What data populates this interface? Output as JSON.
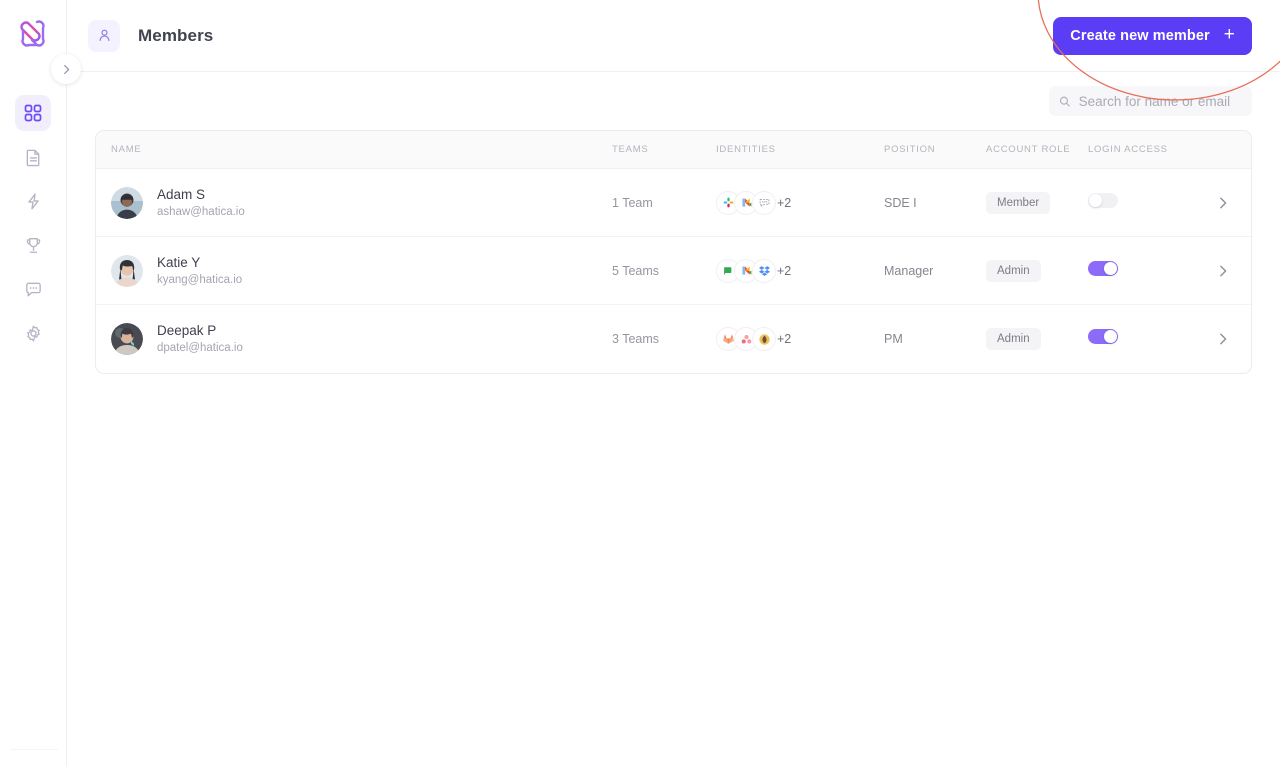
{
  "brand": {
    "logo_name": "hatica-logo",
    "accent": "#5b3df5",
    "accent_light": "#8b6bf7",
    "annotation_color": "#e8705a"
  },
  "sidebar": {
    "items": [
      {
        "icon": "grid-icon",
        "label": "Dashboard",
        "active": true
      },
      {
        "icon": "document-icon",
        "label": "Reports",
        "active": false
      },
      {
        "icon": "bolt-icon",
        "label": "Activity",
        "active": false
      },
      {
        "icon": "trophy-icon",
        "label": "Goals",
        "active": false
      },
      {
        "icon": "chat-icon",
        "label": "Feedback",
        "active": false
      },
      {
        "icon": "gear-icon",
        "label": "Settings",
        "active": false
      }
    ],
    "collapse_icon": "chevron-right-icon"
  },
  "header": {
    "icon": "person-icon",
    "title": "Members",
    "create_button": {
      "label": "Create new member",
      "icon": "plus-icon"
    }
  },
  "search": {
    "placeholder": "Search for name or email",
    "value": "",
    "icon": "search-icon"
  },
  "table": {
    "columns": [
      {
        "key": "name",
        "label": "NAME"
      },
      {
        "key": "teams",
        "label": "TEAMS"
      },
      {
        "key": "ident",
        "label": "IDENTITIES"
      },
      {
        "key": "pos",
        "label": "POSITION"
      },
      {
        "key": "role",
        "label": "ACCOUNT ROLE"
      },
      {
        "key": "login",
        "label": "LOGIN ACCESS"
      }
    ],
    "rows": [
      {
        "name": "Adam S",
        "email": "ashaw@hatica.io",
        "teams": "1 Team",
        "identities": [
          "slack-icon",
          "google-meet-icon",
          "chat-bubble-icon"
        ],
        "identities_more": "+2",
        "position": "SDE I",
        "account_role": "Member",
        "login_access": false,
        "arrow_icon": "chevron-right-icon"
      },
      {
        "name": "Katie Y",
        "email": "kyang@hatica.io",
        "teams": "5 Teams",
        "identities": [
          "green-flag-icon",
          "google-meet-icon",
          "dropbox-icon"
        ],
        "identities_more": "+2",
        "position": "Manager",
        "account_role": "Admin",
        "login_access": true,
        "arrow_icon": "chevron-right-icon"
      },
      {
        "name": "Deepak P",
        "email": "dpatel@hatica.io",
        "teams": "3 Teams",
        "identities": [
          "gitlab-icon",
          "asana-icon",
          "amber-leaf-icon"
        ],
        "identities_more": "+2",
        "position": "PM",
        "account_role": "Admin",
        "login_access": true,
        "arrow_icon": "chevron-right-icon"
      }
    ]
  },
  "annotation": {
    "shape": "ellipse-highlight",
    "target": "Create new member"
  }
}
